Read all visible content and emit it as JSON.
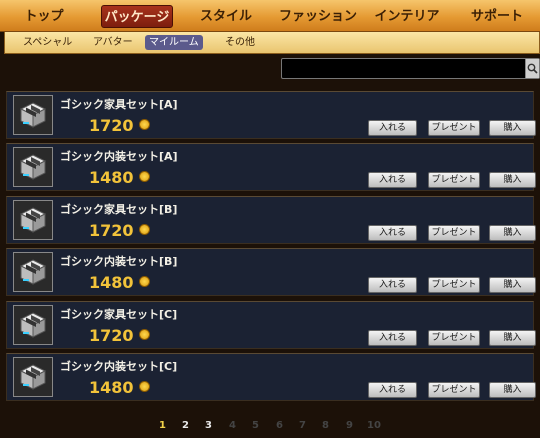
{
  "nav": {
    "tabs": [
      {
        "label": "トップ"
      },
      {
        "label": "パッケージ"
      },
      {
        "label": "スタイル"
      },
      {
        "label": "ファッション"
      },
      {
        "label": "インテリア"
      },
      {
        "label": "サポート"
      }
    ],
    "active_index": 1
  },
  "subnav": {
    "items": [
      {
        "label": "スペシャル"
      },
      {
        "label": "アバター"
      },
      {
        "label": "マイルーム"
      },
      {
        "label": "その他"
      }
    ],
    "active_index": 2
  },
  "search": {
    "value": "",
    "icon": "magnifier-icon"
  },
  "items": [
    {
      "name": "ゴシック家具セット[A]",
      "price": "1720"
    },
    {
      "name": "ゴシック内装セット[A]",
      "price": "1480"
    },
    {
      "name": "ゴシック家具セット[B]",
      "price": "1720"
    },
    {
      "name": "ゴシック内装セット[B]",
      "price": "1480"
    },
    {
      "name": "ゴシック家具セット[C]",
      "price": "1720"
    },
    {
      "name": "ゴシック内装セット[C]",
      "price": "1480"
    }
  ],
  "buttons": {
    "add": "入れる",
    "gift": "プレゼント",
    "buy": "購入"
  },
  "coin_symbol": "円",
  "pagination": {
    "pages": [
      "1",
      "2",
      "3",
      "4",
      "5",
      "6",
      "7",
      "8",
      "9",
      "10"
    ],
    "current": "1",
    "linked": [
      "2",
      "3"
    ]
  },
  "colors": {
    "accent": "#e59a33",
    "price": "#f2c33a",
    "active_tab": "#8b2412"
  }
}
